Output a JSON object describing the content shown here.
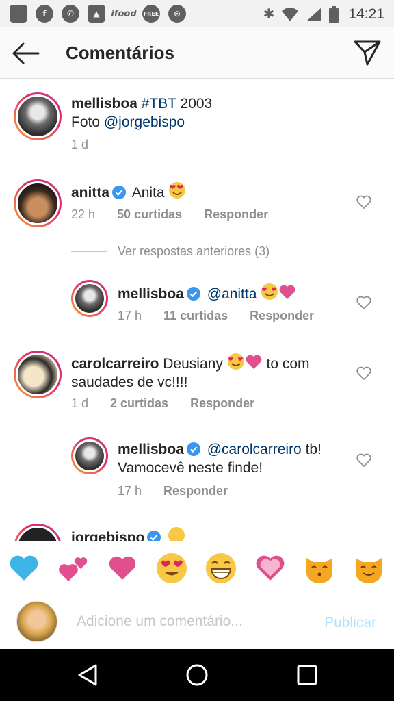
{
  "status_bar": {
    "time": "14:21",
    "icons": [
      "message-icon",
      "facebook-icon",
      "whatsapp-icon",
      "image-icon",
      "ifood-icon",
      "free-icon",
      "search-app-icon",
      "bluetooth-icon",
      "wifi-icon",
      "signal-icon",
      "battery-icon"
    ],
    "ifood_text": "ifood",
    "free_text": "FREE"
  },
  "header": {
    "title": "Comentários"
  },
  "caption": {
    "username": "mellisboa",
    "hashtag": "#TBT",
    "text_after": " 2003",
    "line2_prefix": "Foto ",
    "mention": "@jorgebispo",
    "time": "1 d"
  },
  "comments": [
    {
      "username": "anitta",
      "text": "Anita",
      "time": "22 h",
      "likes": "50 curtidas",
      "reply": "Responder",
      "view_replies": "Ver respostas anteriores (3)"
    },
    {
      "username": "mellisboa",
      "mention": "@anitta",
      "time": "17 h",
      "likes": "11 curtidas",
      "reply": "Responder"
    },
    {
      "username": "carolcarreiro",
      "text_a": "Deusiany",
      "text_b": "to com",
      "text_line2": "saudades de vc!!!!",
      "time": "1 d",
      "likes": "2 curtidas",
      "reply": "Responder"
    },
    {
      "username": "mellisboa",
      "mention": "@carolcarreiro",
      "text_after": " tb!",
      "text_line2": "Vamocevê neste finde!",
      "time": "17 h",
      "reply": "Responder"
    },
    {
      "username": "jorgebispo"
    }
  ],
  "emoji_bar": [
    "blue-heart",
    "two-hearts",
    "pink-heart",
    "heart-eyes",
    "grinning",
    "sparkling-heart",
    "kissing-cat",
    "smiling-cat"
  ],
  "input": {
    "placeholder": "Adicione um comentário...",
    "publish": "Publicar"
  },
  "colors": {
    "link": "#00376b",
    "meta": "#8e8e8e",
    "verified": "#3897f0",
    "publish_disabled": "#b2dffc"
  }
}
